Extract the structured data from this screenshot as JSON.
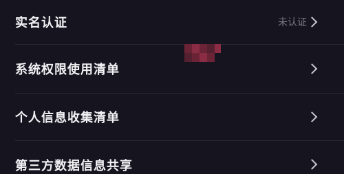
{
  "settings": {
    "items": [
      {
        "label": "实名认证",
        "status": "未认证",
        "chevron_icon": "chevron-right-icon"
      },
      {
        "label": "系统权限使用清单",
        "chevron_icon": "chevron-right-icon"
      },
      {
        "label": "个人信息收集清单",
        "chevron_icon": "chevron-right-icon"
      },
      {
        "label": "第三方数据信息共享",
        "chevron_icon": "chevron-right-icon"
      }
    ]
  },
  "colors": {
    "background": "#16151f",
    "text_primary": "#f2f2f5",
    "text_secondary": "#77767f",
    "divider": "#2a2935",
    "chevron": "#c9c8cf",
    "redaction": "#6b2336"
  }
}
